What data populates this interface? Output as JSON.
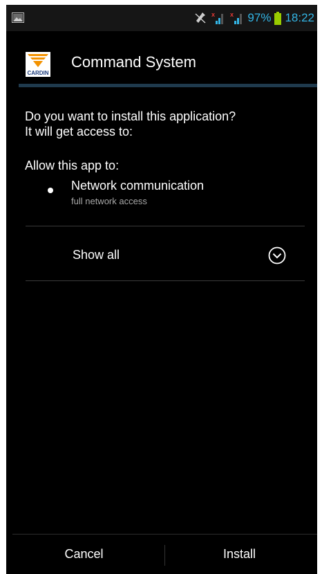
{
  "status_bar": {
    "icons": [
      "gallery-icon",
      "mute-icon",
      "signal-1-icon",
      "signal-2-icon",
      "battery-icon"
    ],
    "battery": "97%",
    "time": "18:22",
    "accent_color": "#33b5e5"
  },
  "dialog": {
    "app_logo_text": "CARDIN",
    "app_title": "Command System",
    "question_line1": "Do you want to install this application?",
    "question_line2": "It will get access to:",
    "allow_label": "Allow this app to:",
    "permissions": [
      {
        "title": "Network communication",
        "subtitle": "full network access"
      }
    ],
    "show_all_label": "Show all"
  },
  "buttons": {
    "cancel": "Cancel",
    "install": "Install"
  }
}
